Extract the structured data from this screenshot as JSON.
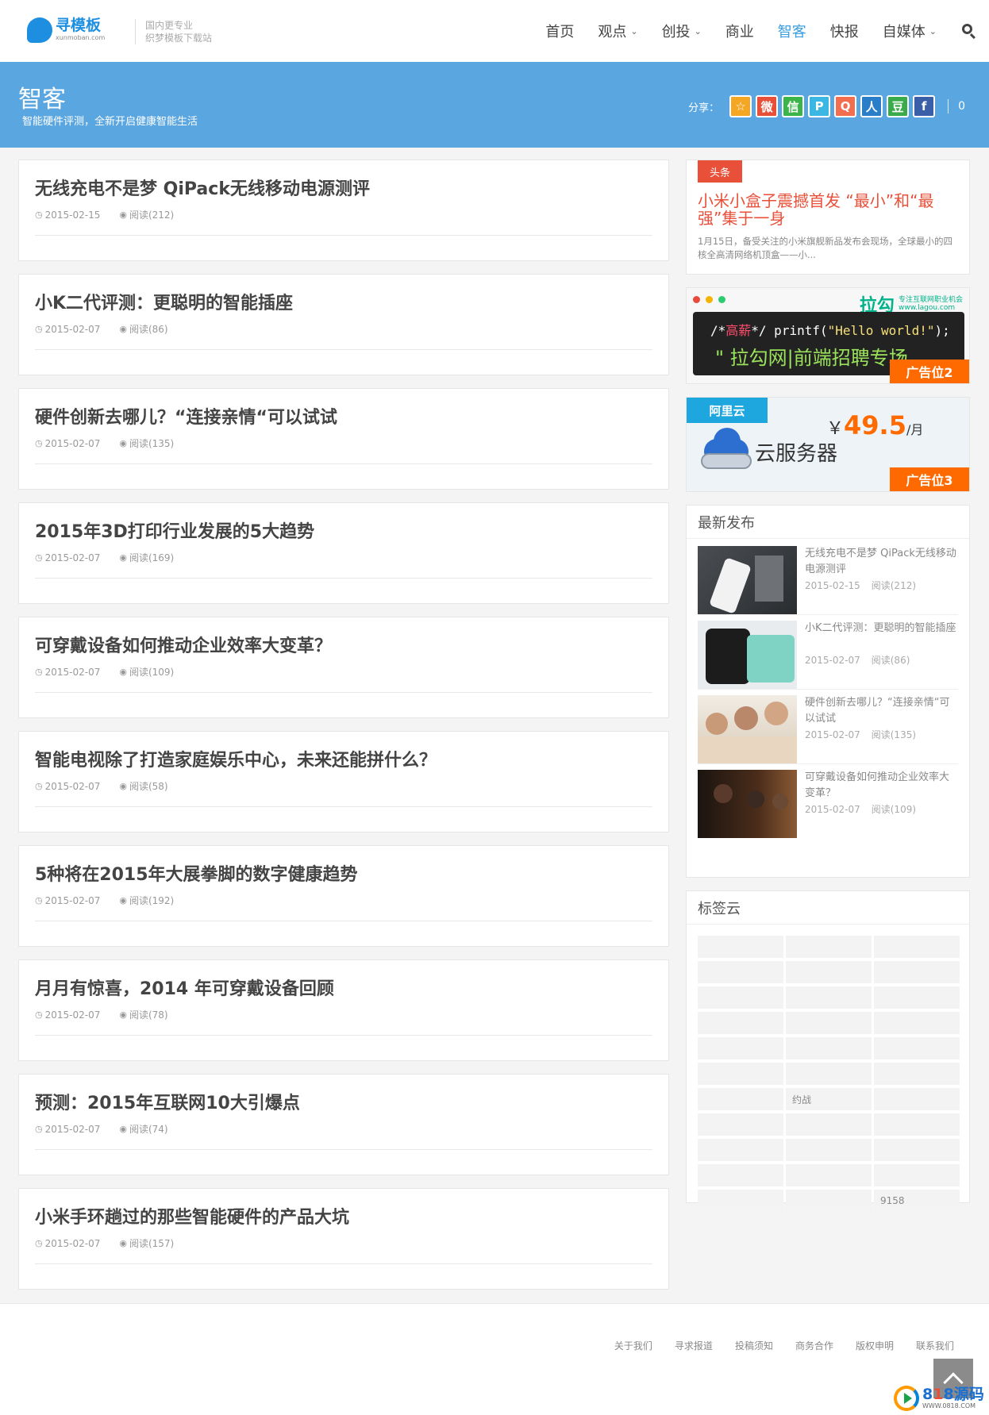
{
  "header": {
    "logo_cn": "寻模板",
    "logo_en": "xunmoban.com",
    "slogan_line1": "国内更专业",
    "slogan_line2": "织梦模板下载站",
    "nav": [
      {
        "label": "首页",
        "dropdown": false,
        "active": false
      },
      {
        "label": "观点",
        "dropdown": true,
        "active": false
      },
      {
        "label": "创投",
        "dropdown": true,
        "active": false
      },
      {
        "label": "商业",
        "dropdown": false,
        "active": false
      },
      {
        "label": "智客",
        "dropdown": false,
        "active": true
      },
      {
        "label": "快报",
        "dropdown": false,
        "active": false
      },
      {
        "label": "自媒体",
        "dropdown": true,
        "active": false
      }
    ]
  },
  "banner": {
    "title": "智客",
    "subtitle": "智能硬件评测，全新开启健康智能生活",
    "share_label": "分享：",
    "share_buttons": [
      {
        "glyph": "☆",
        "color": "#f5a623",
        "icon": "qzone-icon"
      },
      {
        "glyph": "微",
        "color": "#e8503a",
        "icon": "weibo-icon"
      },
      {
        "glyph": "信",
        "color": "#3bb44a",
        "icon": "wechat-icon"
      },
      {
        "glyph": "P",
        "color": "#3cb6e3",
        "icon": "tencent-weibo-icon"
      },
      {
        "glyph": "Q",
        "color": "#f36d4f",
        "icon": "qq-icon"
      },
      {
        "glyph": "人",
        "color": "#2a7ec9",
        "icon": "renren-icon"
      },
      {
        "glyph": "豆",
        "color": "#3aab4a",
        "icon": "douban-icon"
      },
      {
        "glyph": "f",
        "color": "#3b5ea8",
        "icon": "facebook-icon"
      }
    ],
    "share_count": "0"
  },
  "articles": [
    {
      "title": "无线充电不是梦 QiPack无线移动电源测评",
      "date": "2015-02-15",
      "views": "阅读(212)"
    },
    {
      "title": "小K二代评测：更聪明的智能插座",
      "date": "2015-02-07",
      "views": "阅读(86)"
    },
    {
      "title": "硬件创新去哪儿？“连接亲情“可以试试",
      "date": "2015-02-07",
      "views": "阅读(135)"
    },
    {
      "title": "2015年3D打印行业发展的5大趋势",
      "date": "2015-02-07",
      "views": "阅读(169)"
    },
    {
      "title": "可穿戴设备如何推动企业效率大变革？",
      "date": "2015-02-07",
      "views": "阅读(109)"
    },
    {
      "title": "智能电视除了打造家庭娱乐中心，未来还能拼什么？",
      "date": "2015-02-07",
      "views": "阅读(58)"
    },
    {
      "title": "5种将在2015年大展拳脚的数字健康趋势",
      "date": "2015-02-07",
      "views": "阅读(192)"
    },
    {
      "title": "月月有惊喜，2014 年可穿戴设备回顾",
      "date": "2015-02-07",
      "views": "阅读(78)"
    },
    {
      "title": "预测：2015年互联网10大引爆点",
      "date": "2015-02-07",
      "views": "阅读(74)"
    },
    {
      "title": "小米手环趟过的那些智能硬件的产品大坑",
      "date": "2015-02-07",
      "views": "阅读(157)"
    }
  ],
  "sidebar": {
    "headline": {
      "tag": "头条",
      "title": "小米小盒子震撼首发 “最小”和“最强”集于一身",
      "desc": "1月15日，备受关注的小米旗舰新品发布会现场，全球最小的四核全高清网络机顶盒——小..."
    },
    "ad2": {
      "brand_cn": "拉勾",
      "brand_en_line1": "专注互联网职业机会",
      "brand_en_line2": "www.lagou.com",
      "code_prefix": "/*",
      "code_highlight": "高薪",
      "code_mid": "*/ printf(",
      "code_string": "\"Hello world!\"",
      "code_suffix": ");",
      "slogan": "\" 拉勾网|前端招聘专场",
      "badge": "广告位2"
    },
    "ad3": {
      "brand": "阿里云",
      "currency": "￥",
      "price": "49.5",
      "unit": "/月",
      "product": "云服务器",
      "badge": "广告位3"
    },
    "recent": {
      "title": "最新发布",
      "items": [
        {
          "title": "无线充电不是梦 QiPack无线移动电源测评",
          "date": "2015-02-15",
          "views": "阅读(212)"
        },
        {
          "title": "小K二代评测：更聪明的智能插座",
          "date": "2015-02-07",
          "views": "阅读(86)"
        },
        {
          "title": "硬件创新去哪儿？“连接亲情“可以试试",
          "date": "2015-02-07",
          "views": "阅读(135)"
        },
        {
          "title": "可穿戴设备如何推动企业效率大变革？",
          "date": "2015-02-07",
          "views": "阅读(109)"
        }
      ]
    },
    "tags": {
      "title": "标签云",
      "cells": [
        "",
        "",
        "",
        "",
        "",
        "",
        "",
        "",
        "",
        "",
        "",
        "",
        "",
        "",
        "",
        "",
        "",
        "",
        "",
        "约战",
        "",
        "",
        "",
        "",
        "",
        "",
        "",
        "",
        "",
        "",
        "",
        "",
        "9158"
      ]
    }
  },
  "footer": {
    "links": [
      "关于我们",
      "寻求报道",
      "投稿须知",
      "商务合作",
      "版权申明",
      "联系我们"
    ]
  },
  "watermark": {
    "num1": "8",
    "num2": "1",
    "num3": "8",
    "cn": "源码",
    "en": "WWW.0818.COM"
  }
}
